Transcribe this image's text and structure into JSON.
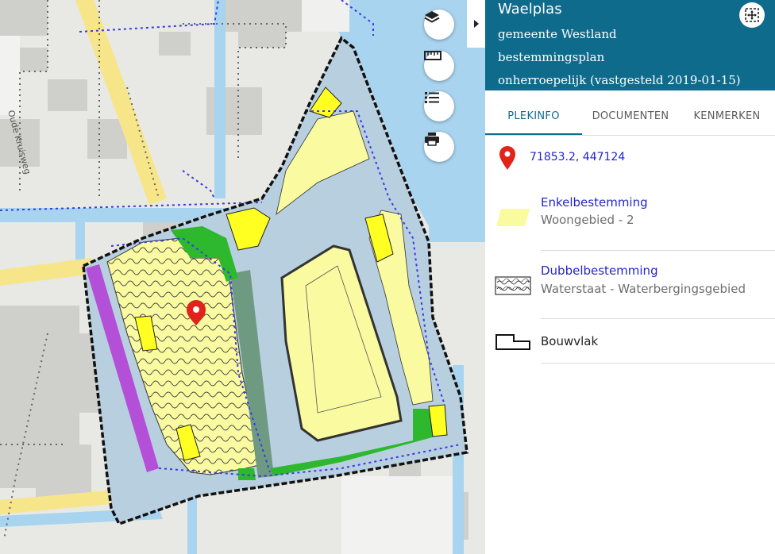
{
  "panel": {
    "title": "Waelplas",
    "municipality": "gemeente Westland",
    "plan_type": "bestemmingsplan",
    "status": "onherroepelijk (vastgesteld 2019-01-15)",
    "header_color": "#0f6b8c"
  },
  "tabs": [
    {
      "label": "PLEKINFO",
      "active": true
    },
    {
      "label": "DOCUMENTEN",
      "active": false
    },
    {
      "label": "KENMERKEN",
      "active": false
    }
  ],
  "location": {
    "coordinates": "71853.2, 447124",
    "marker_icon": "map-pin-icon",
    "marker_color": "#e2231a"
  },
  "legend": [
    {
      "title": "Enkelbestemming",
      "subtitle": "Woongebied - 2",
      "icon": "yellow-area-swatch",
      "color": "#fafaa0"
    },
    {
      "title": "Dubbelbestemming",
      "subtitle": "Waterstaat - Waterbergingsgebied",
      "icon": "wave-pattern-swatch"
    },
    {
      "title": "Bouwvlak",
      "icon": "building-outline-swatch"
    }
  ],
  "map": {
    "street_label": "Oude Kruisweg",
    "toolbar": [
      "layers-icon",
      "ruler-icon",
      "list-icon",
      "print-icon"
    ],
    "colors": {
      "water": "#a9d4ef",
      "plan_area": "#b8cfe0",
      "residential": "#fafaa0",
      "building": "#ffff22",
      "green": "#2db82d",
      "dark_green": "#6f9a82",
      "purple": "#b44fd8",
      "plan_border": "#111111",
      "route_blue": "#3a3ae6"
    }
  }
}
